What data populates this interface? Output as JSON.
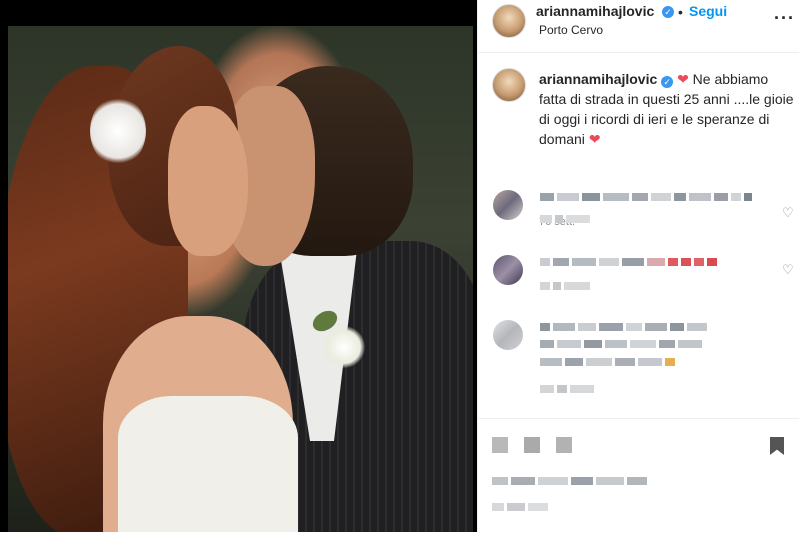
{
  "post": {
    "username": "ariannamihajlovic",
    "follow_label": "Segui",
    "separator": "•",
    "location": "Porto Cervo",
    "more_label": "···",
    "caption_user": "ariannamihajlovic",
    "caption_text": " Ne abbiamo fatta di strada in questi 25 anni ....le gioie di oggi i ricordi di ieri e le speranze di domani ",
    "heart_glyph": "❤",
    "time_ago": "76 sett."
  },
  "colors": {
    "accent": "#0095f6",
    "heart": "#ed4956",
    "verified": "#3897f0"
  },
  "icons": {
    "verified": "verified-badge-icon",
    "more": "more-options-icon",
    "like": "heart-outline-icon"
  }
}
